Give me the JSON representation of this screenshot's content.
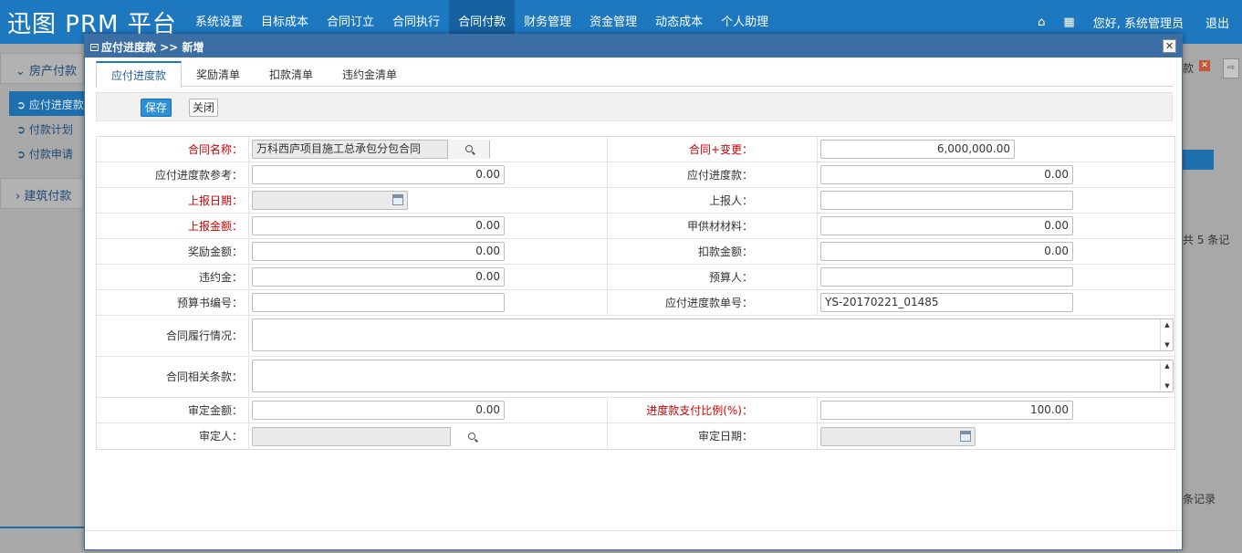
{
  "app": {
    "title": "迅图 PRM 平台"
  },
  "topnav": [
    {
      "label": "系统设置",
      "active": false
    },
    {
      "label": "目标成本",
      "active": false
    },
    {
      "label": "合同订立",
      "active": false
    },
    {
      "label": "合同执行",
      "active": false
    },
    {
      "label": "合同付款",
      "active": true
    },
    {
      "label": "财务管理",
      "active": false
    },
    {
      "label": "资金管理",
      "active": false
    },
    {
      "label": "动态成本",
      "active": false
    },
    {
      "label": "个人助理",
      "active": false
    }
  ],
  "user": {
    "greeting": "您好, 系统管理员",
    "logout": "退出",
    "home_icon": "⌂",
    "grid_icon": "▦"
  },
  "sidebar": {
    "group1": "房产付款",
    "items": [
      "应付进度款",
      "付款计划",
      "付款申请"
    ],
    "group2": "建筑付款"
  },
  "background_right": {
    "kuan": "款",
    "x": "✕",
    "arrow": "⇨",
    "count_text": "共 5 条记",
    "records_text": "条记录"
  },
  "modal": {
    "title": "应付进度款 >> 新增",
    "close": "✕",
    "tabs": [
      "应付进度款",
      "奖励清单",
      "扣款清单",
      "违约金清单"
    ],
    "buttons": {
      "save": "保存",
      "close": "关闭"
    }
  },
  "form": {
    "contract_name_label": "合同名称：",
    "contract_name": "万科西庐项目施工总承包分包合同",
    "contract_change_label": "合同+变更：",
    "contract_change": "6,000,000.00",
    "payable_ref_label": "应付进度款参考：",
    "payable_ref": "0.00",
    "payable_label": "应付进度款：",
    "payable": "0.00",
    "report_date_label": "上报日期：",
    "reporter_label": "上报人：",
    "report_amount_label": "上报金额：",
    "report_amount": "0.00",
    "supplied_material_label": "甲供材材料：",
    "supplied_material": "0.00",
    "reward_amount_label": "奖励金额：",
    "reward_amount": "0.00",
    "deduct_amount_label": "扣款金额：",
    "deduct_amount": "0.00",
    "penalty_label": "违约金：",
    "penalty": "0.00",
    "budgeter_label": "预算人：",
    "budget_no_label": "预算书编号：",
    "payable_no_label": "应付进度款单号：",
    "payable_no": "YS-20170221_01485",
    "performance_label": "合同履行情况：",
    "clauses_label": "合同相关条款：",
    "approved_amount_label": "审定金额：",
    "approved_amount": "0.00",
    "pay_ratio_label": "进度款支付比例(%)：",
    "pay_ratio": "100.00",
    "approver_label": "审定人：",
    "approve_date_label": "审定日期："
  },
  "colors": {
    "topbar": "#1e78c0",
    "modal_header": "#3b6ea4",
    "save_button": "#2d8fd6",
    "required_label": "#cc0000"
  }
}
